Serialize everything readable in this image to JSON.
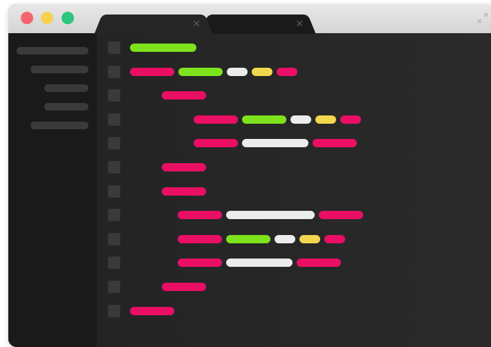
{
  "window": {
    "traffic_lights": {
      "close_color": "#f4656f",
      "minimize_color": "#f5d24e",
      "zoom_color": "#2bc67a"
    },
    "tabs": [
      {
        "close_icon": "close-icon",
        "close_glyph": "✕",
        "active": true
      },
      {
        "close_icon": "close-icon",
        "close_glyph": "✕",
        "active": false
      }
    ],
    "fullscreen_icon": "fullscreen-icon"
  },
  "sidebar": {
    "items": [
      {
        "indent": 0
      },
      {
        "indent": 1
      },
      {
        "indent": 2
      },
      {
        "indent": 2
      },
      {
        "indent": 1
      }
    ],
    "item_color": "#3a3a3a"
  },
  "editor": {
    "gutter_color": "#3a3a3a",
    "colors": {
      "pink": "#ea0f64",
      "green": "#7de31c",
      "white": "#ececec",
      "yellow": "#f2d64e"
    },
    "lines": [
      {
        "indent": 0,
        "tokens": [
          {
            "c": "green",
            "w": 3
          }
        ]
      },
      {
        "indent": 0,
        "tokens": [
          {
            "c": "pink",
            "w": 2
          },
          {
            "c": "green",
            "w": 2
          },
          {
            "c": "white",
            "w": 1
          },
          {
            "c": "yellow",
            "w": 1
          },
          {
            "c": "pink",
            "w": 1
          }
        ]
      },
      {
        "indent": 1,
        "tokens": [
          {
            "c": "pink",
            "w": 2
          }
        ]
      },
      {
        "indent": 2,
        "tokens": [
          {
            "c": "pink",
            "w": 2
          },
          {
            "c": "green",
            "w": 2
          },
          {
            "c": "white",
            "w": 1
          },
          {
            "c": "yellow",
            "w": 1
          },
          {
            "c": "pink",
            "w": 1
          }
        ]
      },
      {
        "indent": 2,
        "tokens": [
          {
            "c": "pink",
            "w": 2
          },
          {
            "c": "white",
            "w": 3
          },
          {
            "c": "pink",
            "w": 2
          }
        ]
      },
      {
        "indent": 1,
        "tokens": [
          {
            "c": "pink",
            "w": 2
          }
        ]
      },
      {
        "indent": 1,
        "tokens": [
          {
            "c": "pink",
            "w": 2
          }
        ]
      },
      {
        "indent": 1.5,
        "tokens": [
          {
            "c": "pink",
            "w": 2
          },
          {
            "c": "white",
            "w": 4
          },
          {
            "c": "pink",
            "w": 2
          }
        ]
      },
      {
        "indent": 1.5,
        "tokens": [
          {
            "c": "pink",
            "w": 2
          },
          {
            "c": "green",
            "w": 2
          },
          {
            "c": "white",
            "w": 1
          },
          {
            "c": "yellow",
            "w": 1
          },
          {
            "c": "pink",
            "w": 1
          }
        ]
      },
      {
        "indent": 1.5,
        "tokens": [
          {
            "c": "pink",
            "w": 2
          },
          {
            "c": "white",
            "w": 3
          },
          {
            "c": "pink",
            "w": 2
          }
        ]
      },
      {
        "indent": 1,
        "tokens": [
          {
            "c": "pink",
            "w": 2
          }
        ]
      },
      {
        "indent": 0,
        "tokens": [
          {
            "c": "pink",
            "w": 2
          }
        ]
      }
    ]
  }
}
